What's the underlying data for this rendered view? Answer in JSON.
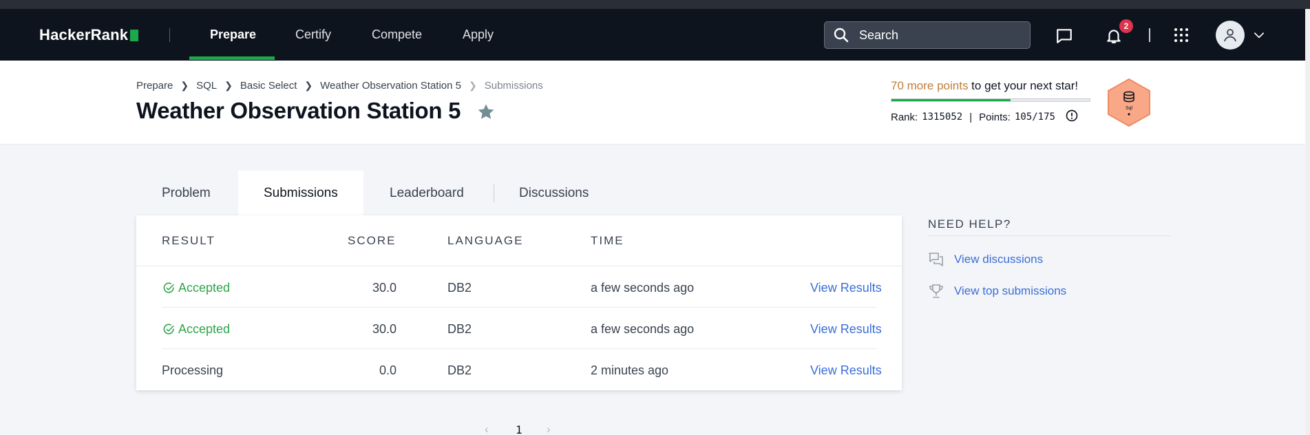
{
  "navbar": {
    "logo": "HackerRank",
    "tabs": [
      {
        "label": "Prepare",
        "active": true
      },
      {
        "label": "Certify",
        "active": false
      },
      {
        "label": "Compete",
        "active": false
      },
      {
        "label": "Apply",
        "active": false
      }
    ],
    "search_placeholder": "Search",
    "notification_count": "2",
    "accent_color": "#1ba94c"
  },
  "breadcrumb": [
    "Prepare",
    "SQL",
    "Basic Select",
    "Weather Observation Station 5",
    "Submissions"
  ],
  "page_title": "Weather Observation Station 5",
  "progress": {
    "highlight": "70 more points",
    "rest": " to get your next star!",
    "rank_label": "Rank:",
    "rank_value": "1315052",
    "points_label": "Points:",
    "points_value": "105/175",
    "fraction": 0.6,
    "badge_label": "Sql"
  },
  "tabs": [
    {
      "label": "Problem",
      "active": false
    },
    {
      "label": "Submissions",
      "active": true
    },
    {
      "label": "Leaderboard",
      "active": false
    },
    {
      "label": "Discussions",
      "active": false
    }
  ],
  "table": {
    "headers": [
      "RESULT",
      "SCORE",
      "LANGUAGE",
      "TIME"
    ],
    "rows": [
      {
        "result": "Accepted",
        "status": "accepted",
        "score": "30.0",
        "language": "DB2",
        "time": "a few seconds ago",
        "action": "View Results"
      },
      {
        "result": "Accepted",
        "status": "accepted",
        "score": "30.0",
        "language": "DB2",
        "time": "a few seconds ago",
        "action": "View Results"
      },
      {
        "result": "Processing",
        "status": "processing",
        "score": "0.0",
        "language": "DB2",
        "time": "2 minutes ago",
        "action": "View Results"
      }
    ]
  },
  "pagination": {
    "current_page": "1"
  },
  "help": {
    "title": "NEED HELP?",
    "links": [
      "View discussions",
      "View top submissions"
    ]
  }
}
